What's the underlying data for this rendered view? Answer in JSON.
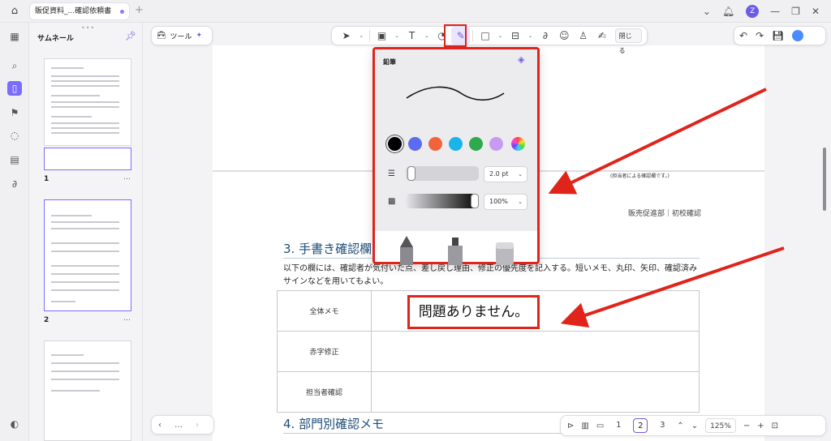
{
  "titlebar": {
    "tab_title": "販促資料_...確認依頼書",
    "avatar_letter": "Z"
  },
  "thumbnails": {
    "title": "サムネール",
    "pages": [
      {
        "number": "1",
        "more": "…"
      },
      {
        "number": "2",
        "more": "…"
      }
    ]
  },
  "toolbar": {
    "tools_label": "ツール",
    "close_label": "閉じる"
  },
  "pencil_popup": {
    "title": "鉛筆",
    "colors": [
      "#000000",
      "#5b6cf0",
      "#f2623c",
      "#1ab4ea",
      "#2ea94c",
      "#c79bf2"
    ],
    "selected_color": "#000000",
    "thickness": "2.0 pt",
    "opacity": "100%"
  },
  "page": {
    "header_note": "(担当者による確認欄です。)",
    "dept_label": "販売促進部｜初校確認",
    "section3_title": "3. 手書き確認欄",
    "section3_text": "以下の欄には、確認者が気付いた点、差し戻し理由、修正の優先度を記入する。短いメモ、丸印、矢印、確認済みサインなどを用いてもよい。",
    "rows": [
      {
        "label": "全体メモ",
        "value": "問題ありません。"
      },
      {
        "label": "赤字修正",
        "value": ""
      },
      {
        "label": "担当者確認",
        "value": ""
      }
    ],
    "section4_title": "4. 部門別確認メモ"
  },
  "bottom_nav": {
    "pages": [
      "1",
      "2",
      "3"
    ],
    "current_page": "2",
    "zoom": "125%",
    "more": "…"
  }
}
